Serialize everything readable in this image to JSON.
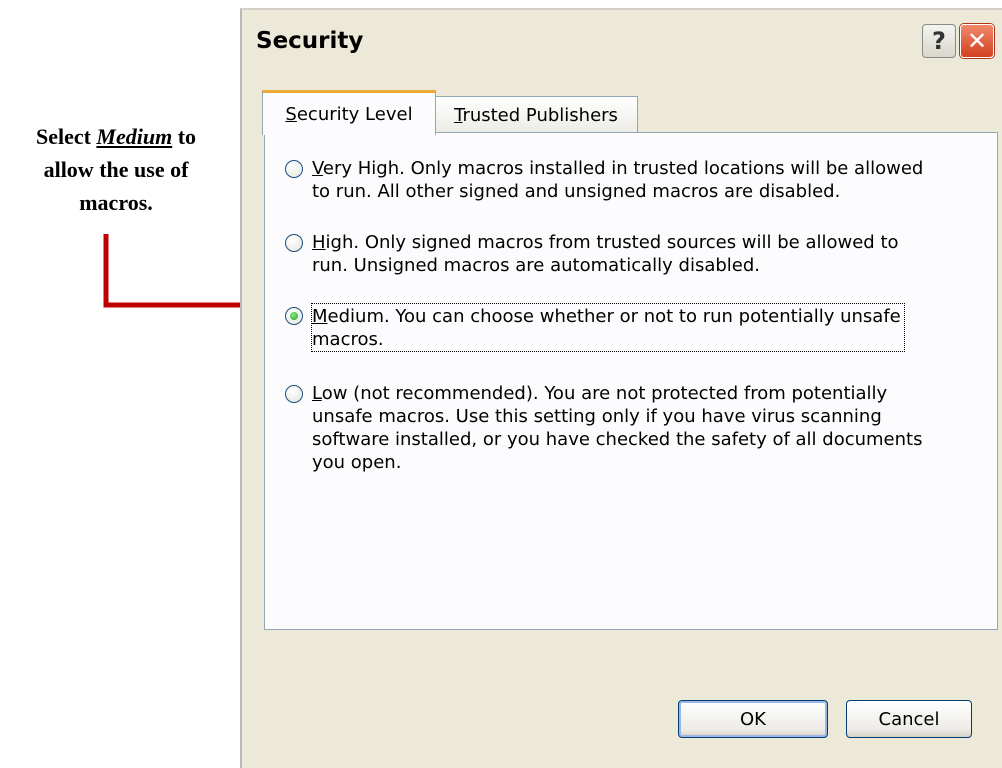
{
  "annotation": {
    "line1_prefix": "Select ",
    "line1_emphasis": "Medium",
    "line1_suffix": " to",
    "line2": "allow the use of",
    "line3": "macros."
  },
  "colors": {
    "arrow": "#c00000",
    "close_button": "#d2401f",
    "tab_highlight": "#f0a935"
  },
  "dialog": {
    "title": "Security",
    "help_label": "?",
    "close_label": "✕",
    "tabs": [
      {
        "prefix": "",
        "mnemonic": "S",
        "rest": "ecurity Level",
        "selected": true
      },
      {
        "prefix": "",
        "mnemonic": "T",
        "rest": "rusted Publishers",
        "selected": false
      }
    ],
    "options": [
      {
        "mnemonic": "V",
        "text": "ery High. Only macros installed in trusted locations will be allowed\nto run. All other signed and unsigned macros are disabled.",
        "checked": false
      },
      {
        "mnemonic": "H",
        "text": "igh. Only signed macros from trusted sources will be allowed to\nrun. Unsigned macros are automatically disabled.",
        "checked": false
      },
      {
        "mnemonic": "M",
        "text": "edium. You can choose whether or not to run potentially unsafe\nmacros.",
        "checked": true
      },
      {
        "mnemonic": "L",
        "text": "ow (not recommended). You are not protected from potentially\nunsafe macros. Use this setting only if you have virus scanning\nsoftware installed, or you have checked the safety of all documents\nyou open.",
        "checked": false
      }
    ],
    "ok_label": "OK",
    "cancel_label": "Cancel"
  }
}
